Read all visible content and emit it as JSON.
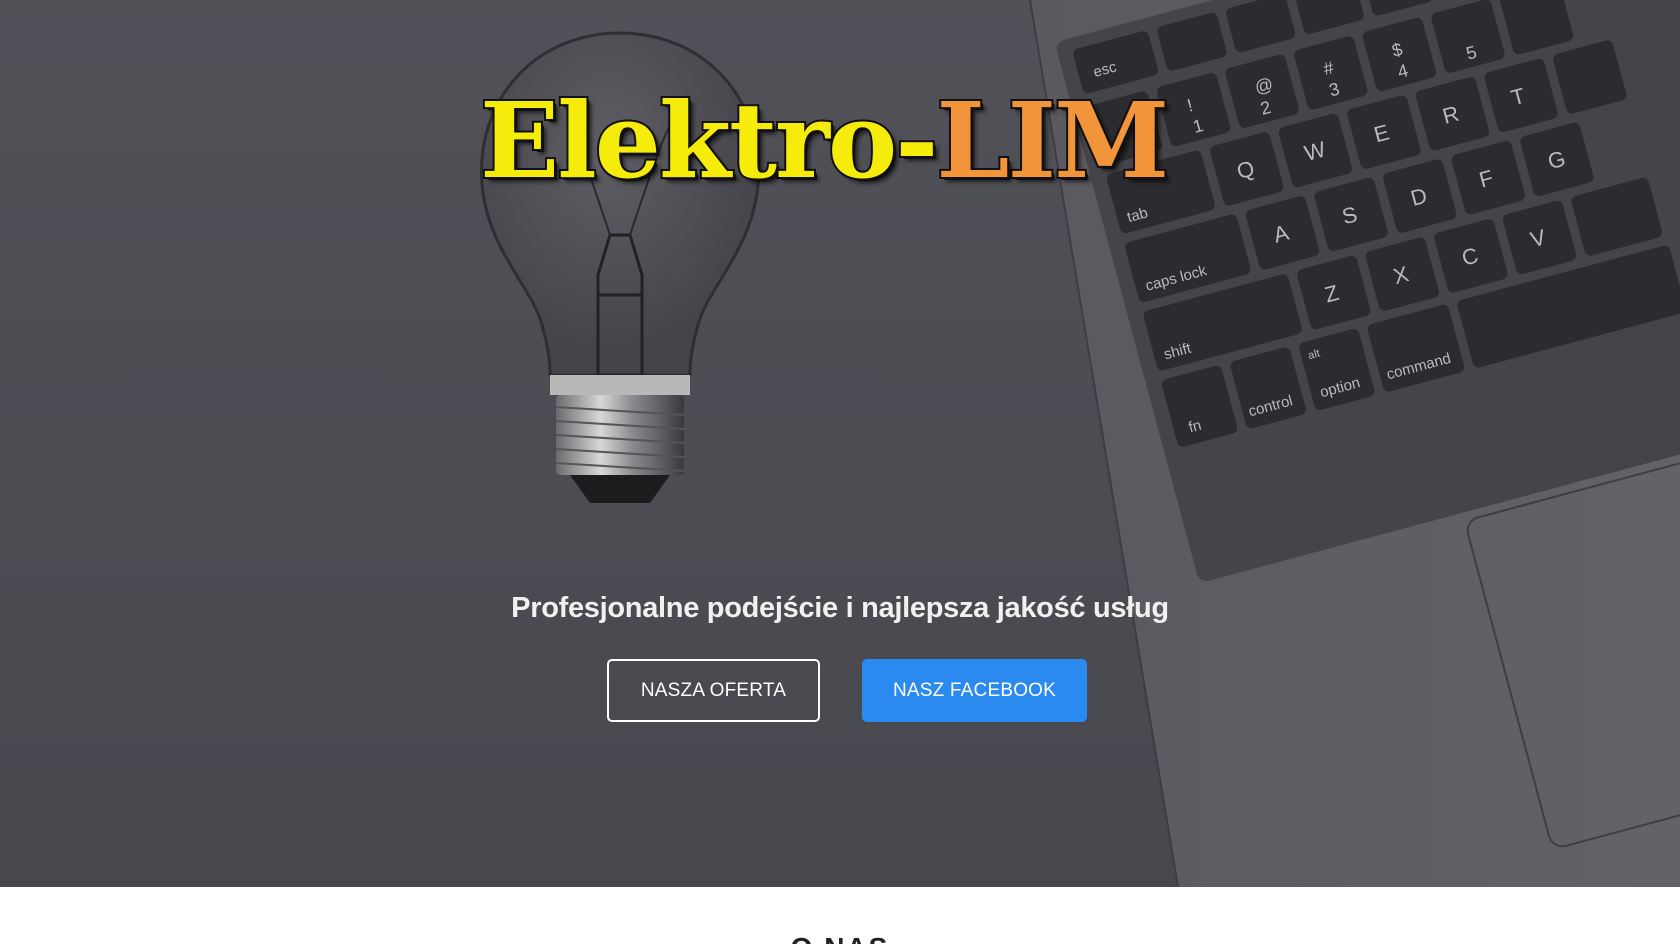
{
  "hero": {
    "logo_part1": "Elektro-",
    "logo_part2": "LIM",
    "tagline": "Profesjonalne podejście i najlepsza jakość usług",
    "buttons": {
      "offer_label": "NASZA OFERTA",
      "facebook_label": "NASZ FACEBOOK"
    },
    "keyboard_keys": {
      "esc": "esc",
      "tab": "tab",
      "caps": "caps lock",
      "shift": "shift",
      "fn": "fn",
      "control": "control",
      "option": "option",
      "command": "command",
      "alt": "alt",
      "q": "Q",
      "w": "W",
      "e": "E",
      "r": "R",
      "t": "T",
      "a": "A",
      "s": "S",
      "d": "D",
      "f": "F",
      "g": "G",
      "z": "Z",
      "x": "X",
      "c": "C",
      "v": "V",
      "n1": "1",
      "n2": "2",
      "n3": "3",
      "n4": "4",
      "n5": "5",
      "s1": "!",
      "s2": "@",
      "s3": "#",
      "s4": "$",
      "tilde": "~"
    }
  },
  "about": {
    "title": "O NAS"
  },
  "colors": {
    "hero_bg": "#4d4d54",
    "logo_yellow": "#f6ec0c",
    "logo_orange": "#f2953a",
    "facebook_blue": "#2a8af0"
  }
}
